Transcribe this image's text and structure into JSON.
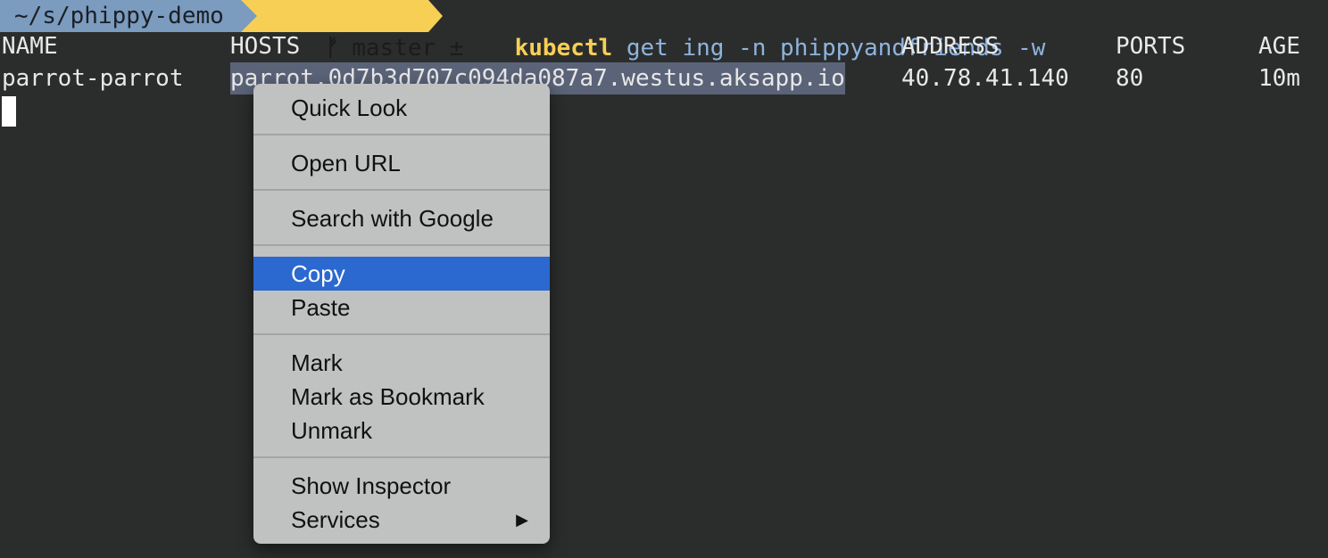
{
  "prompt": {
    "directory": "~/s/phippy-demo",
    "git_branch": "master ±",
    "branch_icon": "git-branch-icon",
    "command": "kubectl",
    "args": "get ing -n phippyandfriends -w"
  },
  "table": {
    "headers": [
      "NAME",
      "HOSTS",
      "ADDRESS",
      "PORTS",
      "AGE"
    ],
    "rows": [
      [
        "parrot-parrot",
        "parrot.0d7b3d707c094da087a7.westus.aksapp.io",
        "40.78.41.140",
        "80",
        "10m"
      ]
    ]
  },
  "context_menu": {
    "items": [
      {
        "label": "Quick Look"
      },
      {
        "label": "Open URL"
      },
      {
        "label": "Search with Google"
      },
      {
        "label": "Copy",
        "selected": true
      },
      {
        "label": "Paste"
      },
      {
        "label": "Mark"
      },
      {
        "label": "Mark as Bookmark"
      },
      {
        "label": "Unmark"
      },
      {
        "label": "Show Inspector"
      },
      {
        "label": "Services",
        "submenu_arrow": "▶"
      }
    ]
  },
  "colors": {
    "background": "#2b2d2d",
    "prompt_dir_bg": "#7b9bbf",
    "prompt_git_bg": "#f8cf55",
    "command": "#f8cf55",
    "args": "#8fb4de",
    "selection_highlight": "#5b6378",
    "menu_bg": "#c0c1c1",
    "menu_selected": "#2b68d0"
  }
}
